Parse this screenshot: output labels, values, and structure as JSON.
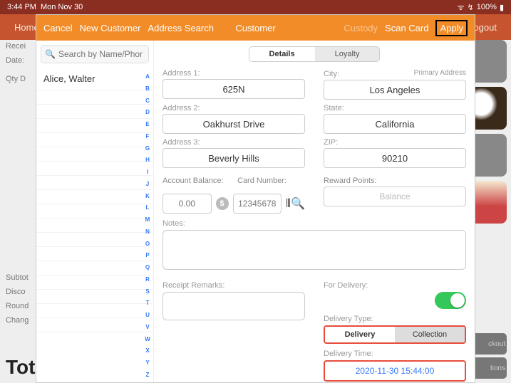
{
  "status": {
    "time": "3:44 PM",
    "date": "Mon Nov 30",
    "battery": "100%"
  },
  "bgnav": {
    "home": "Home",
    "logout": "ogout"
  },
  "bg": {
    "left_lines": [
      "Recei",
      "Date:",
      "",
      "Qty  D"
    ],
    "totals": [
      "Subtot",
      "Disco",
      "Round",
      "Chang"
    ],
    "total_label": "Tot",
    "btn_checkout": "ckout",
    "btn_options": "tions"
  },
  "header": {
    "cancel": "Cancel",
    "new_customer": "New Customer",
    "address_search": "Address Search",
    "title": "Customer",
    "custody": "Custody",
    "scan_card": "Scan Card",
    "apply": "Apply"
  },
  "search": {
    "placeholder": "Search by Name/Phone/..."
  },
  "contacts": [
    {
      "name": "Alice, Walter"
    }
  ],
  "alpha": [
    "A",
    "B",
    "C",
    "D",
    "E",
    "F",
    "G",
    "H",
    "I",
    "J",
    "K",
    "L",
    "M",
    "N",
    "O",
    "P",
    "Q",
    "R",
    "S",
    "T",
    "U",
    "V",
    "W",
    "X",
    "Y",
    "Z"
  ],
  "tabs": {
    "details": "Details",
    "loyalty": "Loyalty"
  },
  "form": {
    "primary_address_label": "Primary Address",
    "addr1_label": "Address 1:",
    "addr1": "625N",
    "addr2_label": "Address 2:",
    "addr2": "Oakhurst Drive",
    "addr3_label": "Address 3:",
    "addr3": "Beverly Hills",
    "city_label": "City:",
    "city": "Los Angeles",
    "state_label": "State:",
    "state": "California",
    "zip_label": "ZIP:",
    "zip": "90210",
    "balance_label": "Account Balance:",
    "balance_placeholder": "0.00",
    "card_label": "Card Number:",
    "card_placeholder": "12345678",
    "reward_label": "Reward Points:",
    "reward_btn": "Balance",
    "notes_label": "Notes:",
    "remarks_label": "Receipt Remarks:",
    "for_delivery_label": "For Delivery:",
    "delivery_type_label": "Delivery Type:",
    "delivery_opt": "Delivery",
    "collection_opt": "Collection",
    "delivery_time_label": "Delivery Time:",
    "delivery_time": "2020-11-30 15:44:00"
  }
}
